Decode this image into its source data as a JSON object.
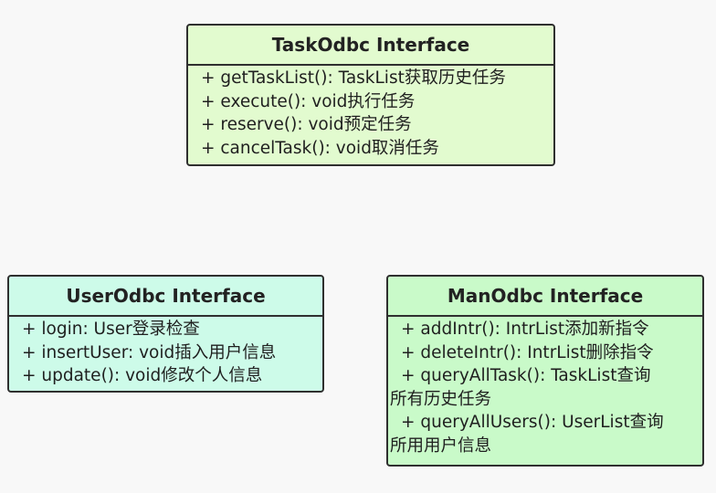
{
  "task_interface": {
    "title": "TaskOdbc Interface",
    "members": [
      "+ getTaskList(): TaskList获取历史任务",
      "+ execute(): void执行任务",
      "+ reserve(): void预定任务",
      "+ cancelTask(): void取消任务"
    ]
  },
  "user_interface": {
    "title": "UserOdbc Interface",
    "members": [
      "+ login: User登录检查",
      "+ insertUser: void插入用户信息",
      "+ update(): void修改个人信息"
    ]
  },
  "man_interface": {
    "title": "ManOdbc Interface",
    "members": [
      "+ addIntr(): IntrList添加新指令",
      "+ deleteIntr(): IntrList删除指令",
      {
        "line1": "+ queryAllTask(): TaskList查询",
        "line2": "所有历史任务"
      },
      {
        "line1": "+ queryAllUsers(): UserList查询",
        "line2": "所用用户信息"
      }
    ]
  },
  "colors": {
    "task_fill": "#e2fbcf",
    "user_fill": "#cdfbe9",
    "man_fill": "#c9fac9",
    "border": "#2f2f2f",
    "background": "#f8f8f8"
  }
}
